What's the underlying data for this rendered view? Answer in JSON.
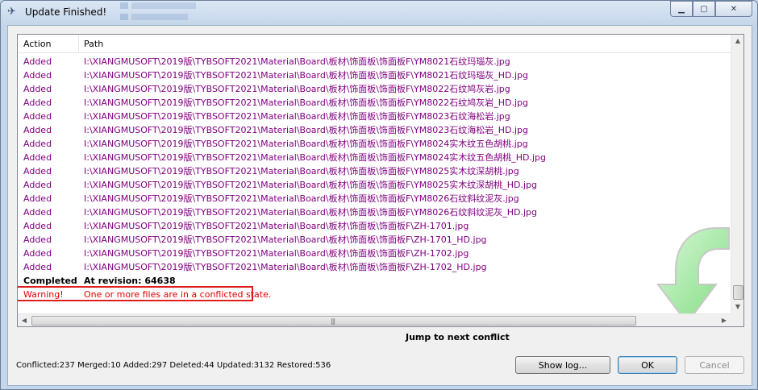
{
  "window": {
    "title": "Update Finished!"
  },
  "list": {
    "columns": {
      "action": "Action",
      "path": "Path"
    },
    "rows": [
      {
        "action": "Added",
        "path": "I:\\XIANGMUSOFT\\2019版\\TYBSOFT2021\\Material\\Board\\板材\\饰面板\\饰面板F\\YM8021石纹玛瑙灰.jpg"
      },
      {
        "action": "Added",
        "path": "I:\\XIANGMUSOFT\\2019版\\TYBSOFT2021\\Material\\Board\\板材\\饰面板\\饰面板F\\YM8021石纹玛瑙灰_HD.jpg"
      },
      {
        "action": "Added",
        "path": "I:\\XIANGMUSOFT\\2019版\\TYBSOFT2021\\Material\\Board\\板材\\饰面板\\饰面板F\\YM8022石纹鸠灰岩.jpg"
      },
      {
        "action": "Added",
        "path": "I:\\XIANGMUSOFT\\2019版\\TYBSOFT2021\\Material\\Board\\板材\\饰面板\\饰面板F\\YM8022石纹鸠灰岩_HD.jpg"
      },
      {
        "action": "Added",
        "path": "I:\\XIANGMUSOFT\\2019版\\TYBSOFT2021\\Material\\Board\\板材\\饰面板\\饰面板F\\YM8023石纹海松岩.jpg"
      },
      {
        "action": "Added",
        "path": "I:\\XIANGMUSOFT\\2019版\\TYBSOFT2021\\Material\\Board\\板材\\饰面板\\饰面板F\\YM8023石纹海松岩_HD.jpg"
      },
      {
        "action": "Added",
        "path": "I:\\XIANGMUSOFT\\2019版\\TYBSOFT2021\\Material\\Board\\板材\\饰面板\\饰面板F\\YM8024实木纹五色胡桃.jpg"
      },
      {
        "action": "Added",
        "path": "I:\\XIANGMUSOFT\\2019版\\TYBSOFT2021\\Material\\Board\\板材\\饰面板\\饰面板F\\YM8024实木纹五色胡桃_HD.jpg"
      },
      {
        "action": "Added",
        "path": "I:\\XIANGMUSOFT\\2019版\\TYBSOFT2021\\Material\\Board\\板材\\饰面板\\饰面板F\\YM8025实木纹深胡桃.jpg"
      },
      {
        "action": "Added",
        "path": "I:\\XIANGMUSOFT\\2019版\\TYBSOFT2021\\Material\\Board\\板材\\饰面板\\饰面板F\\YM8025实木纹深胡桃_HD.jpg"
      },
      {
        "action": "Added",
        "path": "I:\\XIANGMUSOFT\\2019版\\TYBSOFT2021\\Material\\Board\\板材\\饰面板\\饰面板F\\YM8026石纹斜纹泥灰.jpg"
      },
      {
        "action": "Added",
        "path": "I:\\XIANGMUSOFT\\2019版\\TYBSOFT2021\\Material\\Board\\板材\\饰面板\\饰面板F\\YM8026石纹斜纹泥灰_HD.jpg"
      },
      {
        "action": "Added",
        "path": "I:\\XIANGMUSOFT\\2019版\\TYBSOFT2021\\Material\\Board\\板材\\饰面板\\饰面板F\\ZH-1701.jpg"
      },
      {
        "action": "Added",
        "path": "I:\\XIANGMUSOFT\\2019版\\TYBSOFT2021\\Material\\Board\\板材\\饰面板\\饰面板F\\ZH-1701_HD.jpg"
      },
      {
        "action": "Added",
        "path": "I:\\XIANGMUSOFT\\2019版\\TYBSOFT2021\\Material\\Board\\板材\\饰面板\\饰面板F\\ZH-1702.jpg"
      },
      {
        "action": "Added",
        "path": "I:\\XIANGMUSOFT\\2019版\\TYBSOFT2021\\Material\\Board\\板材\\饰面板\\饰面板F\\ZH-1702_HD.jpg"
      }
    ],
    "completed": {
      "action": "Completed",
      "path": "At revision: 64638"
    },
    "warning": {
      "action": "Warning!",
      "path": "One or more files are in a conflicted state."
    }
  },
  "jump_link": "Jump to next conflict",
  "stats": "Conflicted:237 Merged:10 Added:297 Deleted:44 Updated:3132 Restored:536",
  "buttons": {
    "show_log": "Show log...",
    "ok": "OK",
    "cancel": "Cancel"
  },
  "colors": {
    "added": "#800080",
    "warning": "#e00000",
    "highlight_box": "#e02020",
    "arrow": "#8fe88f"
  },
  "icons": {
    "title": "tortoise-icon",
    "minimize": "minimize-icon",
    "maximize": "maximize-icon",
    "close": "close-icon",
    "status": "green-curved-arrow-icon"
  }
}
